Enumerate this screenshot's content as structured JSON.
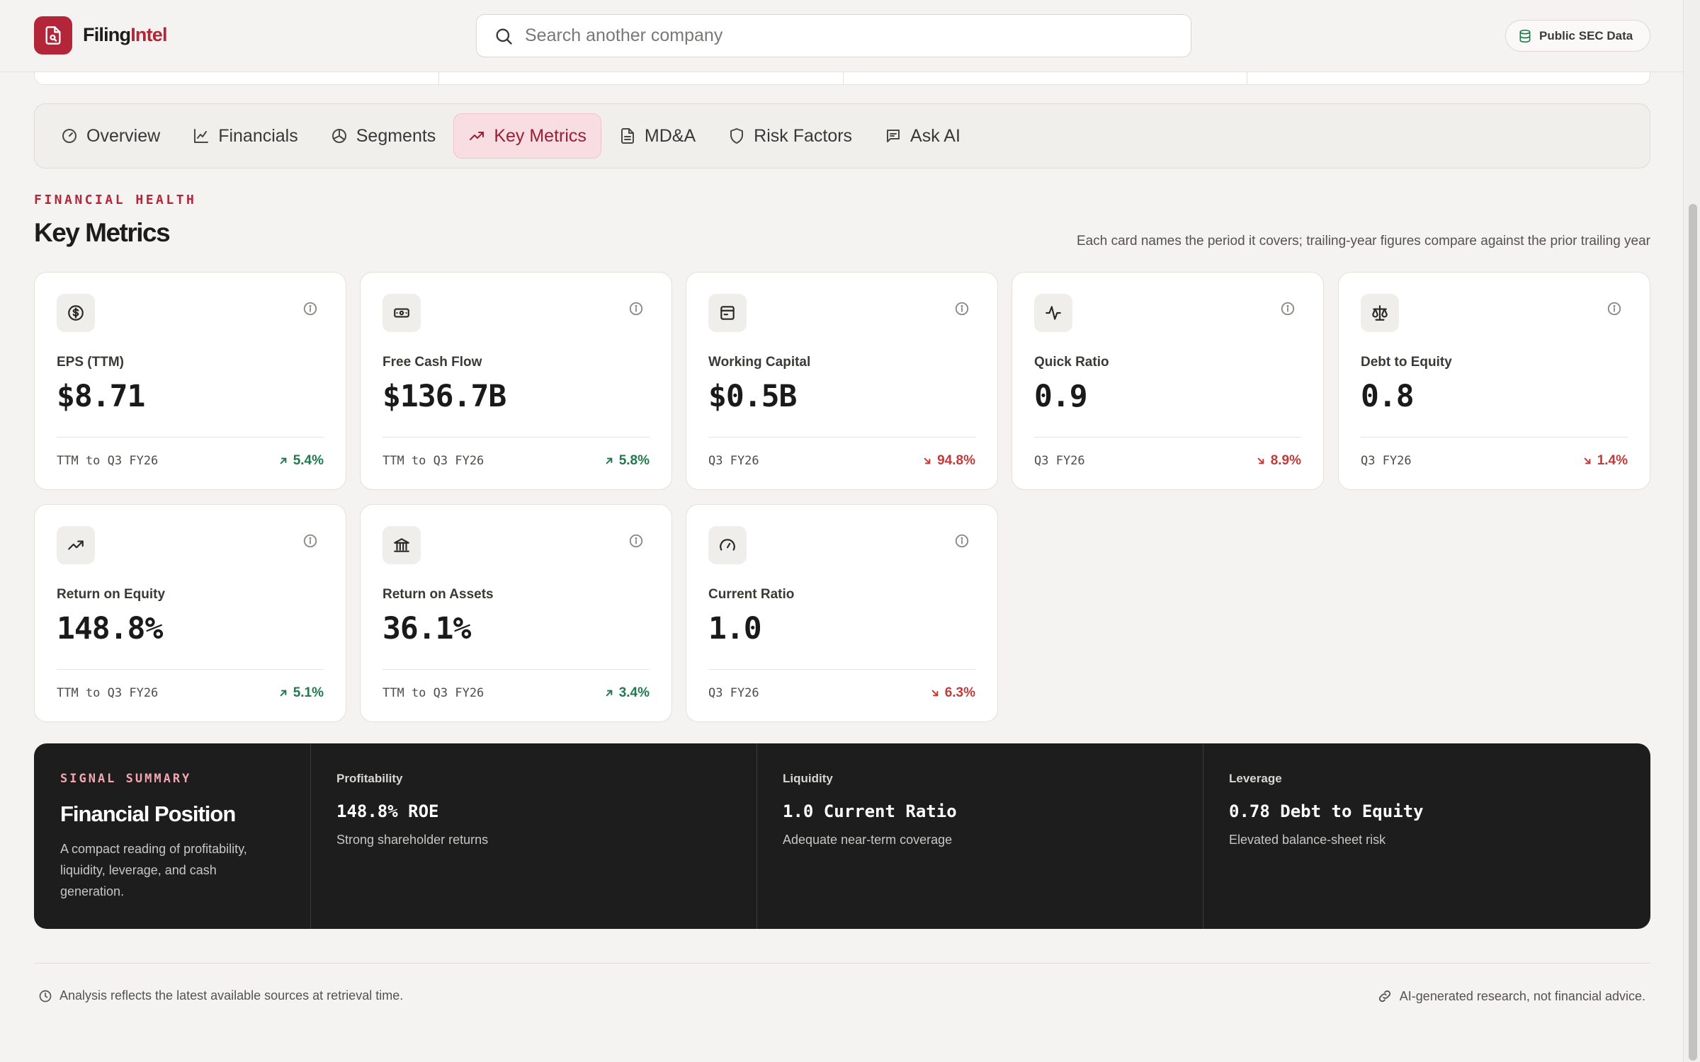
{
  "header": {
    "brand_part1": "Filing",
    "brand_part2": "Intel",
    "search_placeholder": "Search another company",
    "badge": "Public SEC Data"
  },
  "tabs": [
    {
      "label": "Overview",
      "icon": "gauge-icon",
      "active": false
    },
    {
      "label": "Financials",
      "icon": "line-chart-icon",
      "active": false
    },
    {
      "label": "Segments",
      "icon": "pie-chart-icon",
      "active": false
    },
    {
      "label": "Key Metrics",
      "icon": "trending-up-icon",
      "active": true
    },
    {
      "label": "MD&A",
      "icon": "document-icon",
      "active": false
    },
    {
      "label": "Risk Factors",
      "icon": "shield-icon",
      "active": false
    },
    {
      "label": "Ask AI",
      "icon": "chat-icon",
      "active": false
    }
  ],
  "section": {
    "eyebrow": "FINANCIAL HEALTH",
    "title": "Key Metrics",
    "note": "Each card names the period it covers; trailing-year figures compare against the prior trailing year"
  },
  "cards": [
    {
      "label": "EPS (TTM)",
      "value": "$8.71",
      "period": "TTM to Q3 FY26",
      "change": "5.4%",
      "direction": "up",
      "icon": "dollar-circle-icon"
    },
    {
      "label": "Free Cash Flow",
      "value": "$136.7B",
      "period": "TTM to Q3 FY26",
      "change": "5.8%",
      "direction": "up",
      "icon": "banknote-icon"
    },
    {
      "label": "Working Capital",
      "value": "$0.5B",
      "period": "Q3 FY26",
      "change": "94.8%",
      "direction": "down",
      "icon": "wallet-icon"
    },
    {
      "label": "Quick Ratio",
      "value": "0.9",
      "period": "Q3 FY26",
      "change": "8.9%",
      "direction": "down",
      "icon": "pulse-icon"
    },
    {
      "label": "Debt to Equity",
      "value": "0.8",
      "period": "Q3 FY26",
      "change": "1.4%",
      "direction": "down",
      "icon": "scale-icon"
    },
    {
      "label": "Return on Equity",
      "value": "148.8%",
      "period": "TTM to Q3 FY26",
      "change": "5.1%",
      "direction": "up",
      "icon": "trending-up-icon"
    },
    {
      "label": "Return on Assets",
      "value": "36.1%",
      "period": "TTM to Q3 FY26",
      "change": "3.4%",
      "direction": "up",
      "icon": "bank-icon"
    },
    {
      "label": "Current Ratio",
      "value": "1.0",
      "period": "Q3 FY26",
      "change": "6.3%",
      "direction": "down",
      "icon": "speedometer-icon"
    }
  ],
  "summary": {
    "eyebrow": "SIGNAL SUMMARY",
    "title": "Financial Position",
    "description": "A compact reading of profitability, liquidity, leverage, and cash generation.",
    "columns": [
      {
        "key": "Profitability",
        "value": "148.8% ROE",
        "desc": "Strong shareholder returns"
      },
      {
        "key": "Liquidity",
        "value": "1.0 Current Ratio",
        "desc": "Adequate near-term coverage"
      },
      {
        "key": "Leverage",
        "value": "0.78 Debt to Equity",
        "desc": "Elevated balance-sheet risk"
      }
    ]
  },
  "footer": {
    "left": "Analysis reflects the latest available sources at retrieval time.",
    "right": "AI-generated research, not financial advice."
  },
  "colors": {
    "brand": "#b3263a",
    "up": "#1f7a4d",
    "down": "#c23a3a",
    "summary_bg": "#1d1d1d"
  }
}
